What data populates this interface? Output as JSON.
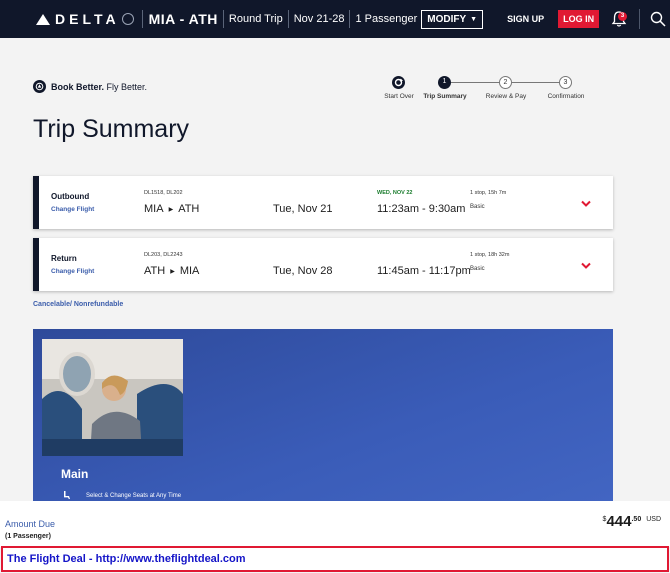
{
  "header": {
    "logo_text": "DELTA",
    "route": "MIA - ATH",
    "trip_type": "Round Trip",
    "dates": "Nov 21-28",
    "passengers": "1 Passenger",
    "modify_label": "MODIFY",
    "signup_label": "SIGN UP",
    "login_label": "LOG IN",
    "notification_count": "3",
    "colors": {
      "nav_bg": "#10172a",
      "login_bg": "#e01933"
    }
  },
  "banner": {
    "brand_bold": "Book Better.",
    "brand_rest": " Fly Better."
  },
  "steps": [
    {
      "number": "",
      "label": "Start Over",
      "state": "icon"
    },
    {
      "number": "1",
      "label": "Trip Summary",
      "state": "current"
    },
    {
      "number": "2",
      "label": "Review & Pay",
      "state": "pending"
    },
    {
      "number": "3",
      "label": "Confirmation",
      "state": "pending"
    }
  ],
  "page_title": "Trip Summary",
  "flights": [
    {
      "type": "Outbound",
      "change_label": "Change Flight",
      "flight_numbers": "DL1518, DL202",
      "origin": "MIA",
      "destination": "ATH",
      "date": "Tue, Nov 21",
      "next_day_note": "WED, NOV 22",
      "times": "11:23am - 9:30am",
      "stops": "1 stop, 15h 7m",
      "fare": "Basic"
    },
    {
      "type": "Return",
      "change_label": "Change Flight",
      "flight_numbers": "DL203, DL2243",
      "origin": "ATH",
      "destination": "MIA",
      "date": "Tue, Nov 28",
      "next_day_note": "",
      "times": "11:45am - 11:17pm",
      "stops": "1 stop, 18h 32m",
      "fare": "Basic"
    }
  ],
  "cancel_policy": "Cancelable/ Nonrefundable",
  "cabin": {
    "name": "Main",
    "feature": "Select & Change Seats at Any Time"
  },
  "footer": {
    "amount_label": "Amount Due",
    "passenger_note": "(1 Passenger)",
    "currency_symbol": "$",
    "price_whole": "444",
    "price_cents": ".50",
    "currency_code": "USD"
  },
  "deal_banner": {
    "text": "The Flight Deal - http://www.theflightdeal.com"
  }
}
